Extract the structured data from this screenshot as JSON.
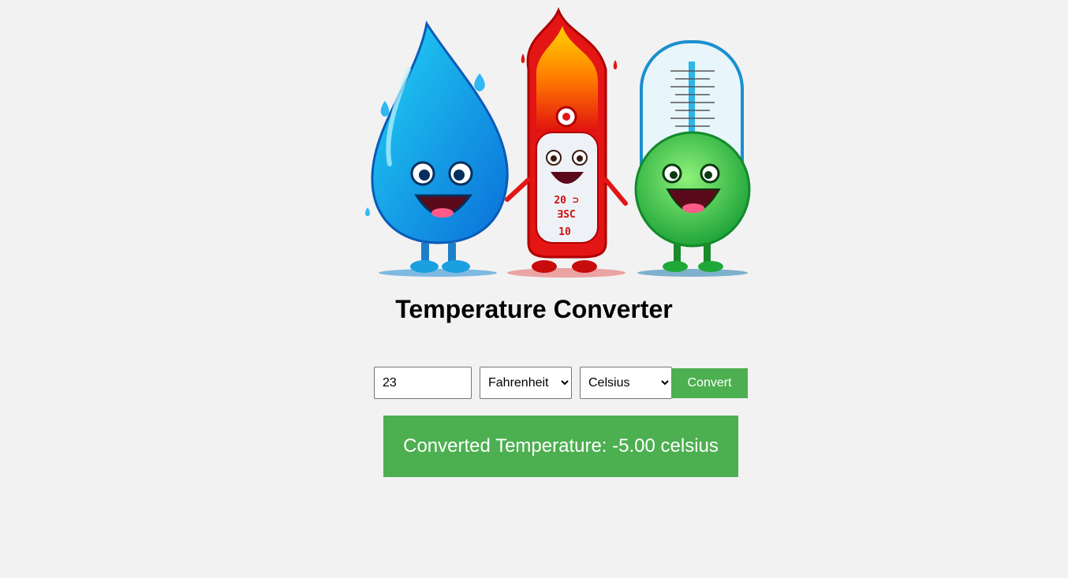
{
  "hero": {
    "thermometer_digits": [
      "20 ⊃",
      "∃SC",
      "10"
    ]
  },
  "title": "Temperature Converter",
  "form": {
    "value": "23",
    "from_unit": "Fahrenheit",
    "to_unit": "Celsius",
    "from_options": [
      "Fahrenheit"
    ],
    "to_options": [
      "Celsius"
    ],
    "convert_label": "Convert"
  },
  "result": {
    "text": "Converted Temperature: -5.00 celsius"
  },
  "colors": {
    "accent": "#4caf50",
    "background": "#f2f2f2"
  }
}
